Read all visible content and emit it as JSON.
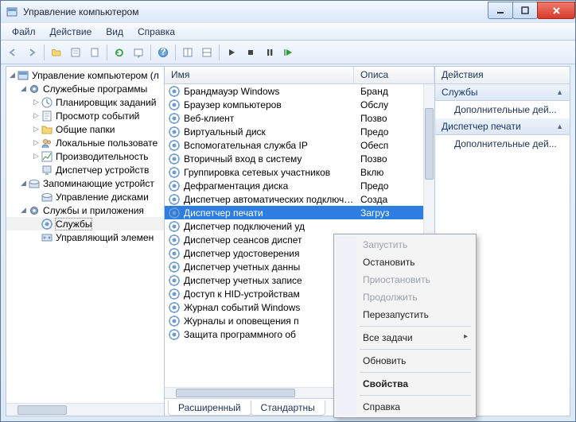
{
  "title": "Управление компьютером",
  "menu": {
    "file": "Файл",
    "action": "Действие",
    "view": "Вид",
    "help": "Справка"
  },
  "tree": {
    "root": "Управление компьютером (л",
    "group_system": "Служебные программы",
    "items_system": [
      "Планировщик заданий",
      "Просмотр событий",
      "Общие папки",
      "Локальные пользовате",
      "Производительность",
      "Диспетчер устройств"
    ],
    "group_storage": "Запоминающие устройст",
    "items_storage": [
      "Управление дисками"
    ],
    "group_services": "Службы и приложения",
    "items_services": [
      "Службы",
      "Управляющий элемен"
    ]
  },
  "columns": {
    "name": "Имя",
    "desc": "Описа"
  },
  "services": [
    {
      "name": "Брандмауэр Windows",
      "desc": "Бранд"
    },
    {
      "name": "Браузер компьютеров",
      "desc": "Обслу"
    },
    {
      "name": "Веб-клиент",
      "desc": "Позво"
    },
    {
      "name": "Виртуальный диск",
      "desc": "Предо"
    },
    {
      "name": "Вспомогательная служба IP",
      "desc": "Обесп"
    },
    {
      "name": "Вторичный вход в систему",
      "desc": "Позво"
    },
    {
      "name": "Группировка сетевых участников",
      "desc": "Вклю"
    },
    {
      "name": "Дефрагментация диска",
      "desc": "Предо"
    },
    {
      "name": "Диспетчер автоматических подключени...",
      "desc": "Созда"
    },
    {
      "name": "Диспетчер печати",
      "desc": "Загруз"
    },
    {
      "name": "Диспетчер подключений уд",
      "desc": ""
    },
    {
      "name": "Диспетчер сеансов диспет",
      "desc": ""
    },
    {
      "name": "Диспетчер удостоверения",
      "desc": ""
    },
    {
      "name": "Диспетчер учетных данны",
      "desc": ""
    },
    {
      "name": "Диспетчер учетных записе",
      "desc": ""
    },
    {
      "name": "Доступ к HID-устройствам",
      "desc": ""
    },
    {
      "name": "Журнал событий Windows",
      "desc": ""
    },
    {
      "name": "Журналы и оповещения п",
      "desc": ""
    },
    {
      "name": "Защита программного об",
      "desc": ""
    }
  ],
  "selected_service_index": 9,
  "tabs": {
    "ext": "Расширенный",
    "std": "Стандартны"
  },
  "actions": {
    "header": "Действия",
    "section1": "Службы",
    "item": "Дополнительные дей...",
    "section2": "Диспетчер печати"
  },
  "context_menu": {
    "start": "Запустить",
    "stop": "Остановить",
    "pause": "Приостановить",
    "resume": "Продолжить",
    "restart": "Перезапустить",
    "all_tasks": "Все задачи",
    "refresh": "Обновить",
    "properties": "Свойства",
    "help": "Справка"
  },
  "icons": {
    "nav_back": "←",
    "nav_fwd": "→"
  }
}
